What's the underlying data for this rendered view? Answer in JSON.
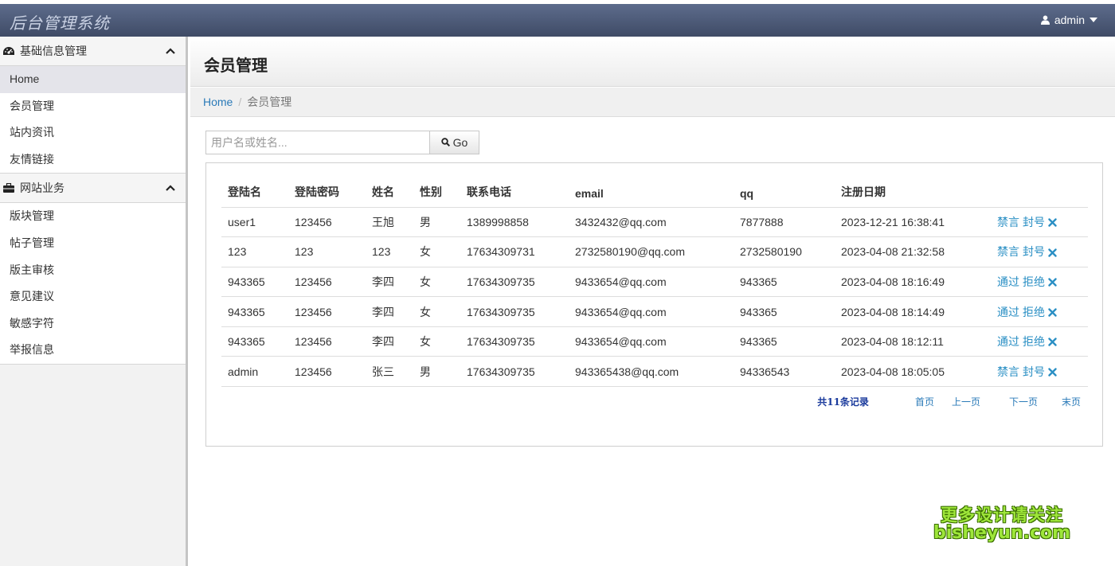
{
  "app": {
    "title": "后台管理系统"
  },
  "user": {
    "name": "admin"
  },
  "sidebar": {
    "sections": [
      {
        "title": "基础信息管理",
        "icon": "dashboard-icon",
        "items": [
          {
            "label": "Home",
            "active": true
          },
          {
            "label": "会员管理"
          },
          {
            "label": "站内资讯"
          },
          {
            "label": "友情链接"
          }
        ]
      },
      {
        "title": "网站业务",
        "icon": "briefcase-icon",
        "items": [
          {
            "label": "版块管理"
          },
          {
            "label": "帖子管理"
          },
          {
            "label": "版主审核"
          },
          {
            "label": "意见建议"
          },
          {
            "label": "敏感字符"
          },
          {
            "label": "举报信息"
          }
        ]
      }
    ]
  },
  "page": {
    "title": "会员管理"
  },
  "breadcrumb": {
    "home": "Home",
    "separator": "/",
    "current": "会员管理"
  },
  "search": {
    "placeholder": "用户名或姓名...",
    "value": "",
    "button_label": "Go"
  },
  "table": {
    "columns": [
      "登陆名",
      "登陆密码",
      "姓名",
      "性别",
      "联系电话",
      "email",
      "qq",
      "注册日期",
      ""
    ],
    "rows": [
      {
        "cells": [
          "user1",
          "123456",
          "王旭",
          "男",
          "1389998858",
          "3432432@qq.com",
          "7877888",
          "2023-12-21 16:38:41"
        ],
        "actions": [
          "禁言",
          "封号"
        ]
      },
      {
        "cells": [
          "123",
          "123",
          "123",
          "女",
          "17634309731",
          "2732580190@qq.com",
          "2732580190",
          "2023-04-08 21:32:58"
        ],
        "actions": [
          "禁言",
          "封号"
        ]
      },
      {
        "cells": [
          "943365",
          "123456",
          "李四",
          "女",
          "17634309735",
          "9433654@qq.com",
          "943365",
          "2023-04-08 18:16:49"
        ],
        "actions": [
          "通过",
          "拒绝"
        ]
      },
      {
        "cells": [
          "943365",
          "123456",
          "李四",
          "女",
          "17634309735",
          "9433654@qq.com",
          "943365",
          "2023-04-08 18:14:49"
        ],
        "actions": [
          "通过",
          "拒绝"
        ]
      },
      {
        "cells": [
          "943365",
          "123456",
          "李四",
          "女",
          "17634309735",
          "9433654@qq.com",
          "943365",
          "2023-04-08 18:12:11"
        ],
        "actions": [
          "通过",
          "拒绝"
        ]
      },
      {
        "cells": [
          "admin",
          "123456",
          "张三",
          "男",
          "17634309735",
          "943365438@qq.com",
          "94336543",
          "2023-04-08 18:05:05"
        ],
        "actions": [
          "禁言",
          "封号"
        ]
      }
    ]
  },
  "pager": {
    "count_text": "共11条记录",
    "first": "首页",
    "prev": "上一页",
    "next": "下一页",
    "last": "末页"
  },
  "watermark": {
    "line1": "更多设计请关注",
    "line2": "bisheyun.com"
  },
  "colors": {
    "link": "#2a8fc4",
    "topbar": "#4a5775",
    "count": "#1a3a9c",
    "watermark": "#9ee63a"
  }
}
